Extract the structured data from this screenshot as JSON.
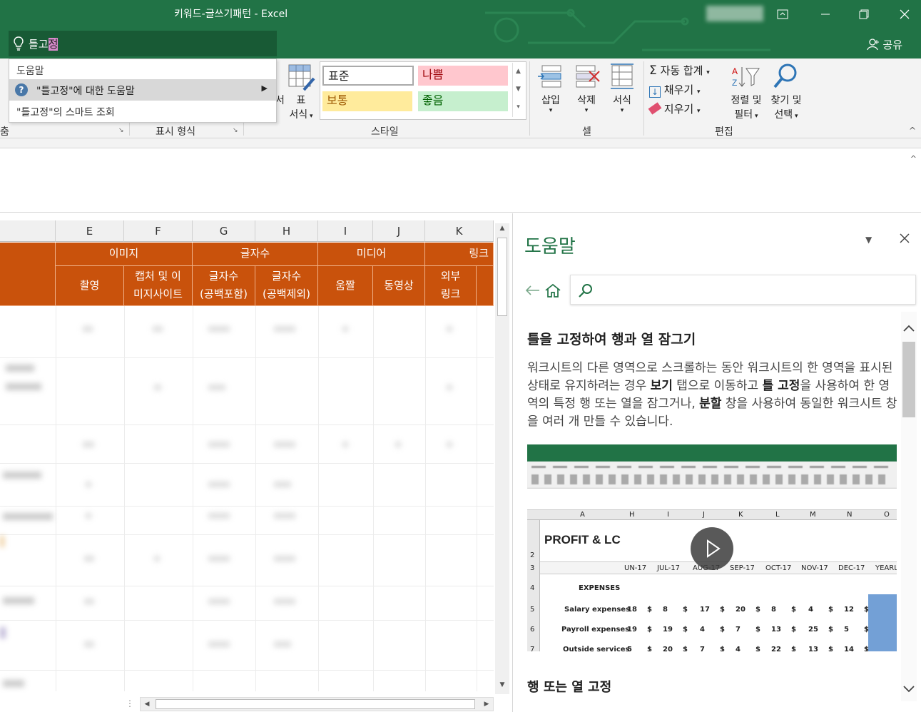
{
  "window": {
    "title": "키워드-글쓰기패턴 - Excel",
    "share_label": "공유",
    "tell_me_prefix": "틀고",
    "tell_me_highlight": "정"
  },
  "dropdown": {
    "header": "도움말",
    "help_item": "\"틀고정\"에 대한 도움말",
    "smart_item": "\"틀고정\"의 스마트 조회"
  },
  "ribbon": {
    "format_table_label": "표",
    "format_table_label2": "서식",
    "groups": {
      "alignment_partial": "춤",
      "number": "표시 형식",
      "styles": "스타일",
      "cells": "셀",
      "editing": "편집"
    },
    "styles": {
      "normal": "표준",
      "bad": "나쁨",
      "neutral": "보통",
      "good": "좋음"
    },
    "cells": {
      "insert": "삽입",
      "delete": "삭제",
      "format": "서식"
    },
    "editing": {
      "autosum": "자동 합계",
      "fill": "채우기",
      "clear": "지우기",
      "sort_filter_1": "정렬 및",
      "sort_filter_2": "필터",
      "find_select_1": "찾기 및",
      "find_select_2": "선택"
    }
  },
  "sheet": {
    "columns": [
      "E",
      "F",
      "G",
      "H",
      "I",
      "J",
      "K"
    ],
    "group_headers": {
      "image": "이미지",
      "chars": "글자수",
      "media": "미디어",
      "link": "링크"
    },
    "sub_headers": {
      "shoot": "촬영",
      "capture_1": "캡처 및 이",
      "capture_2": "미지사이트",
      "chars_with_1": "글자수",
      "chars_with_2": "(공백포함)",
      "chars_without_1": "글자수",
      "chars_without_2": "(공백제외)",
      "gif": "움짤",
      "video": "동영상",
      "external_1": "외부",
      "external_2": "링크"
    }
  },
  "help_pane": {
    "title": "도움말",
    "heading": "틀을 고정하여 행과 열 잠그기",
    "para_part1": "워크시트의 다른 영역으로 스크롤하는 동안 워크시트의 한 영역을 표시된 상태로 유지하려는 경우 ",
    "bold_view": "보기",
    "para_part2": " 탭으로 이동하고 ",
    "bold_freeze": "틀 고정",
    "para_part3": "을 사용하여 한 영역의 특정 행 또는 열을 잠그거나, ",
    "bold_split": "분할",
    "para_part4": " 창을 사용하여 동일한 워크시트 창을 여러 개 만들 수 있습니다.",
    "subheading": "행 또는 열 고정",
    "video": {
      "sheet_title": "PROFIT & LC",
      "col_a": "A",
      "cols": [
        "H",
        "I",
        "J",
        "K",
        "L",
        "M",
        "N",
        "O"
      ],
      "months": [
        "UN-17",
        "JUL-17",
        "AUG-17",
        "SEP-17",
        "OCT-17",
        "NOV-17",
        "DEC-17",
        "YEARL"
      ],
      "rows": [
        "2",
        "3",
        "4",
        "5",
        "6",
        "7"
      ],
      "expenses": "EXPENSES",
      "salary": "Salary expenses",
      "payroll": "Payroll expenses",
      "outside": "Outside services",
      "salary_vals": [
        "18",
        "8",
        "17",
        "20",
        "8",
        "4",
        "12"
      ],
      "payroll_vals": [
        "19",
        "19",
        "4",
        "7",
        "13",
        "25",
        "5"
      ],
      "outside_vals": [
        "5",
        "20",
        "7",
        "4",
        "22",
        "13",
        "14"
      ]
    }
  },
  "colors": {
    "excel_green": "#217346",
    "header_orange": "#c9520c"
  }
}
